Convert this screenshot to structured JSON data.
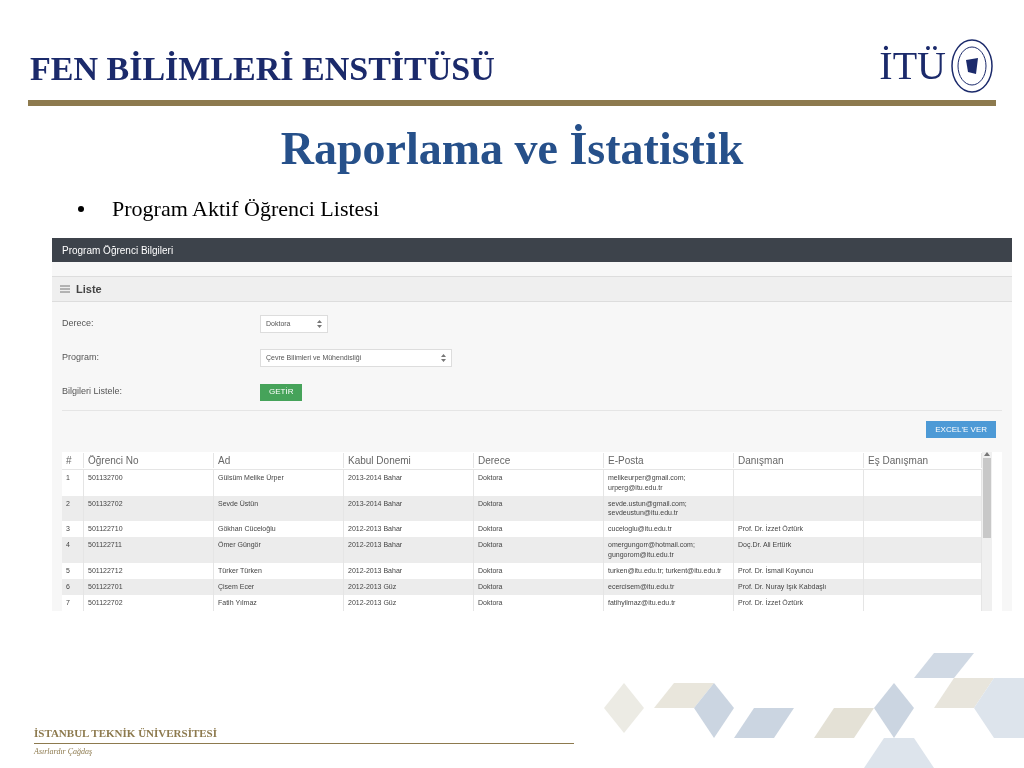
{
  "slide": {
    "header": "FEN BİLİMLERİ ENSTİTÜSÜ",
    "logo_text": "İTÜ",
    "title": "Raporlama ve İstatistik",
    "bullet": "Program Aktif Öğrenci Listesi",
    "footer_name": "İSTANBUL TEKNİK ÜNİVERSİTESİ",
    "footer_motto": "Asırlardır Çağdaş"
  },
  "app": {
    "title": "Program Öğrenci Bilgileri",
    "panel_title": "Liste",
    "fields": [
      {
        "label": "Derece:",
        "kind": "select",
        "value": "Doktora"
      },
      {
        "label": "Program:",
        "kind": "select",
        "value": "Çevre Bilimleri ve Mühendisliği"
      },
      {
        "label": "Bilgileri Listele:",
        "kind": "button",
        "value": "GETİR"
      }
    ],
    "export_button": "EXCEL'E VER",
    "table": {
      "columns": [
        "#",
        "Öğrenci No",
        "Ad",
        "Kabul Donemi",
        "Derece",
        "E-Posta",
        "Danışman",
        "Eş Danışman"
      ],
      "rows": [
        [
          "1",
          "501132700",
          "Gülsüm Melike Ürper",
          "2013-2014 Bahar",
          "Doktora",
          "melikeurper@gmail.com; urperg@itu.edu.tr",
          "",
          ""
        ],
        [
          "2",
          "501132702",
          "Sevde Üstün",
          "2013-2014 Bahar",
          "Doktora",
          "sevde.ustun@gmail.com; sevdeustun@itu.edu.tr",
          "",
          ""
        ],
        [
          "3",
          "501122710",
          "Gökhan Cüceloğlu",
          "2012-2013 Bahar",
          "Doktora",
          "cuceloglu@itu.edu.tr",
          "Prof. Dr. İzzet Öztürk",
          ""
        ],
        [
          "4",
          "501122711",
          "Ömer Güngör",
          "2012-2013 Bahar",
          "Doktora",
          "omergungorr@hotmail.com; gungorom@itu.edu.tr",
          "Doç.Dr. Ali Ertürk",
          ""
        ],
        [
          "5",
          "501122712",
          "Türker Türken",
          "2012-2013 Bahar",
          "Doktora",
          "turken@itu.edu.tr; turkent@itu.edu.tr",
          "Prof. Dr. İsmail Koyuncu",
          ""
        ],
        [
          "6",
          "501122701",
          "Çisem Ecer",
          "2012-2013 Güz",
          "Doktora",
          "ecercisem@itu.edu.tr",
          "Prof. Dr. Nuray Işık Kabdaşlı",
          ""
        ],
        [
          "7",
          "501122702",
          "Fatih Yılmaz",
          "2012-2013 Güz",
          "Doktora",
          "fatihyilmaz@itu.edu.tr",
          "Prof. Dr. İzzet Öztürk",
          ""
        ]
      ]
    }
  }
}
